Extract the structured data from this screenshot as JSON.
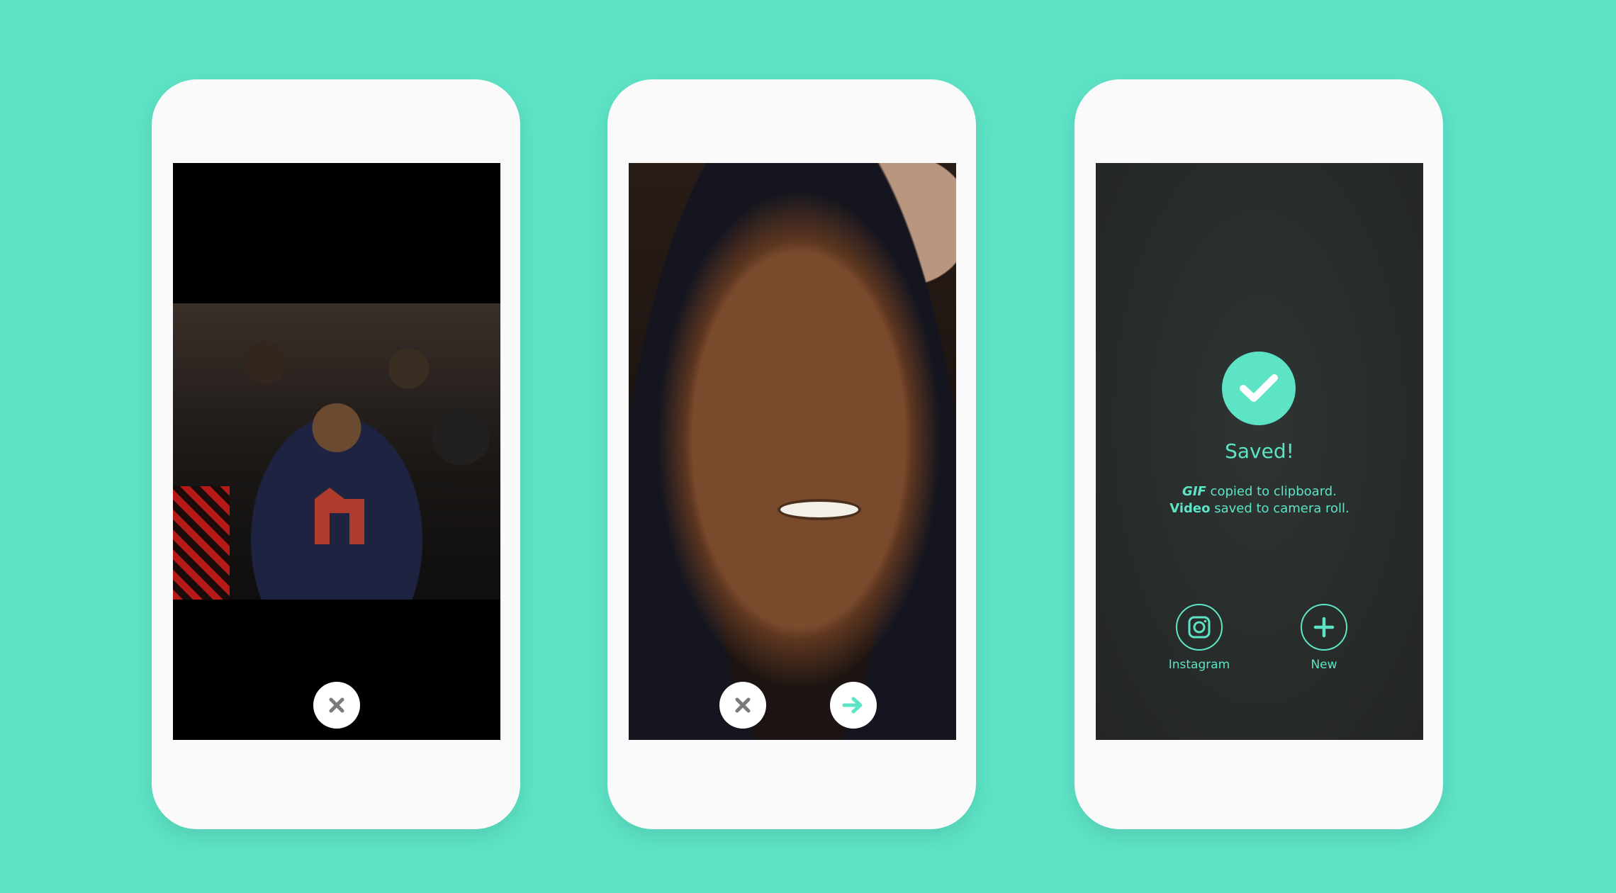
{
  "theme": {
    "background": "#5de3c6",
    "accent": "#5de3c6",
    "saved_screen_bg": "#272b29",
    "button_icon_gray": "#7a7a7a"
  },
  "phone1": {
    "photo": "photo",
    "close_icon": "close-icon"
  },
  "phone2": {
    "photo": "photo",
    "close_icon": "close-icon",
    "next_icon": "arrow-right-icon"
  },
  "phone3": {
    "title": "Saved!",
    "message_line1": {
      "emphasis": "GIF",
      "rest": " copied to clipboard."
    },
    "message_line2": {
      "emphasis": "Video",
      "rest": " saved to camera roll."
    },
    "actions": [
      {
        "label": "Instagram",
        "icon": "instagram-icon"
      },
      {
        "label": "New",
        "icon": "plus-icon"
      }
    ]
  }
}
